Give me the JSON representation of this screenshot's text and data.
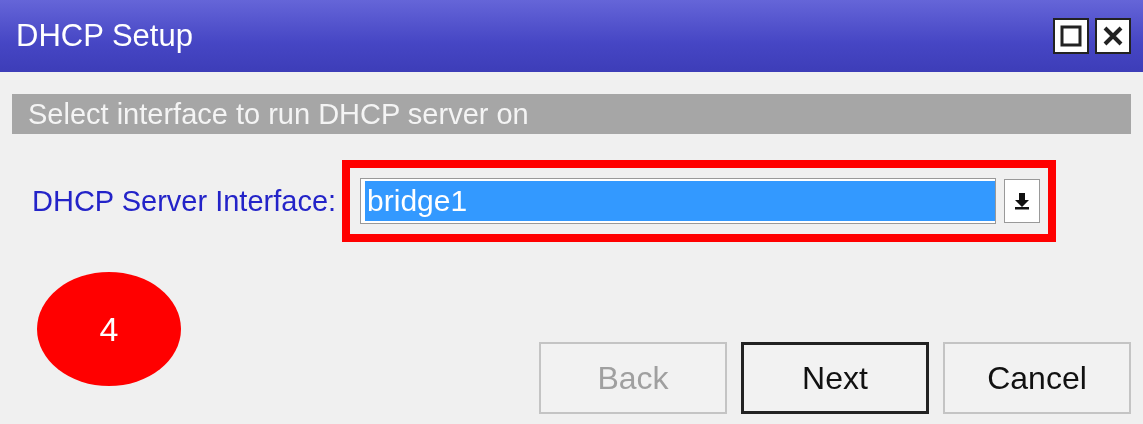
{
  "window": {
    "title": "DHCP Setup"
  },
  "header": "Select interface to run DHCP server on",
  "field": {
    "label": "DHCP Server Interface:",
    "value": "bridge1",
    "text_selected": true,
    "highlighted": true
  },
  "callout": {
    "label": "4",
    "color": "#ff0000"
  },
  "buttons": [
    {
      "label": "Back",
      "disabled": true,
      "focused": false
    },
    {
      "label": "Next",
      "disabled": false,
      "focused": true
    },
    {
      "label": "Cancel",
      "disabled": false,
      "focused": false
    }
  ]
}
